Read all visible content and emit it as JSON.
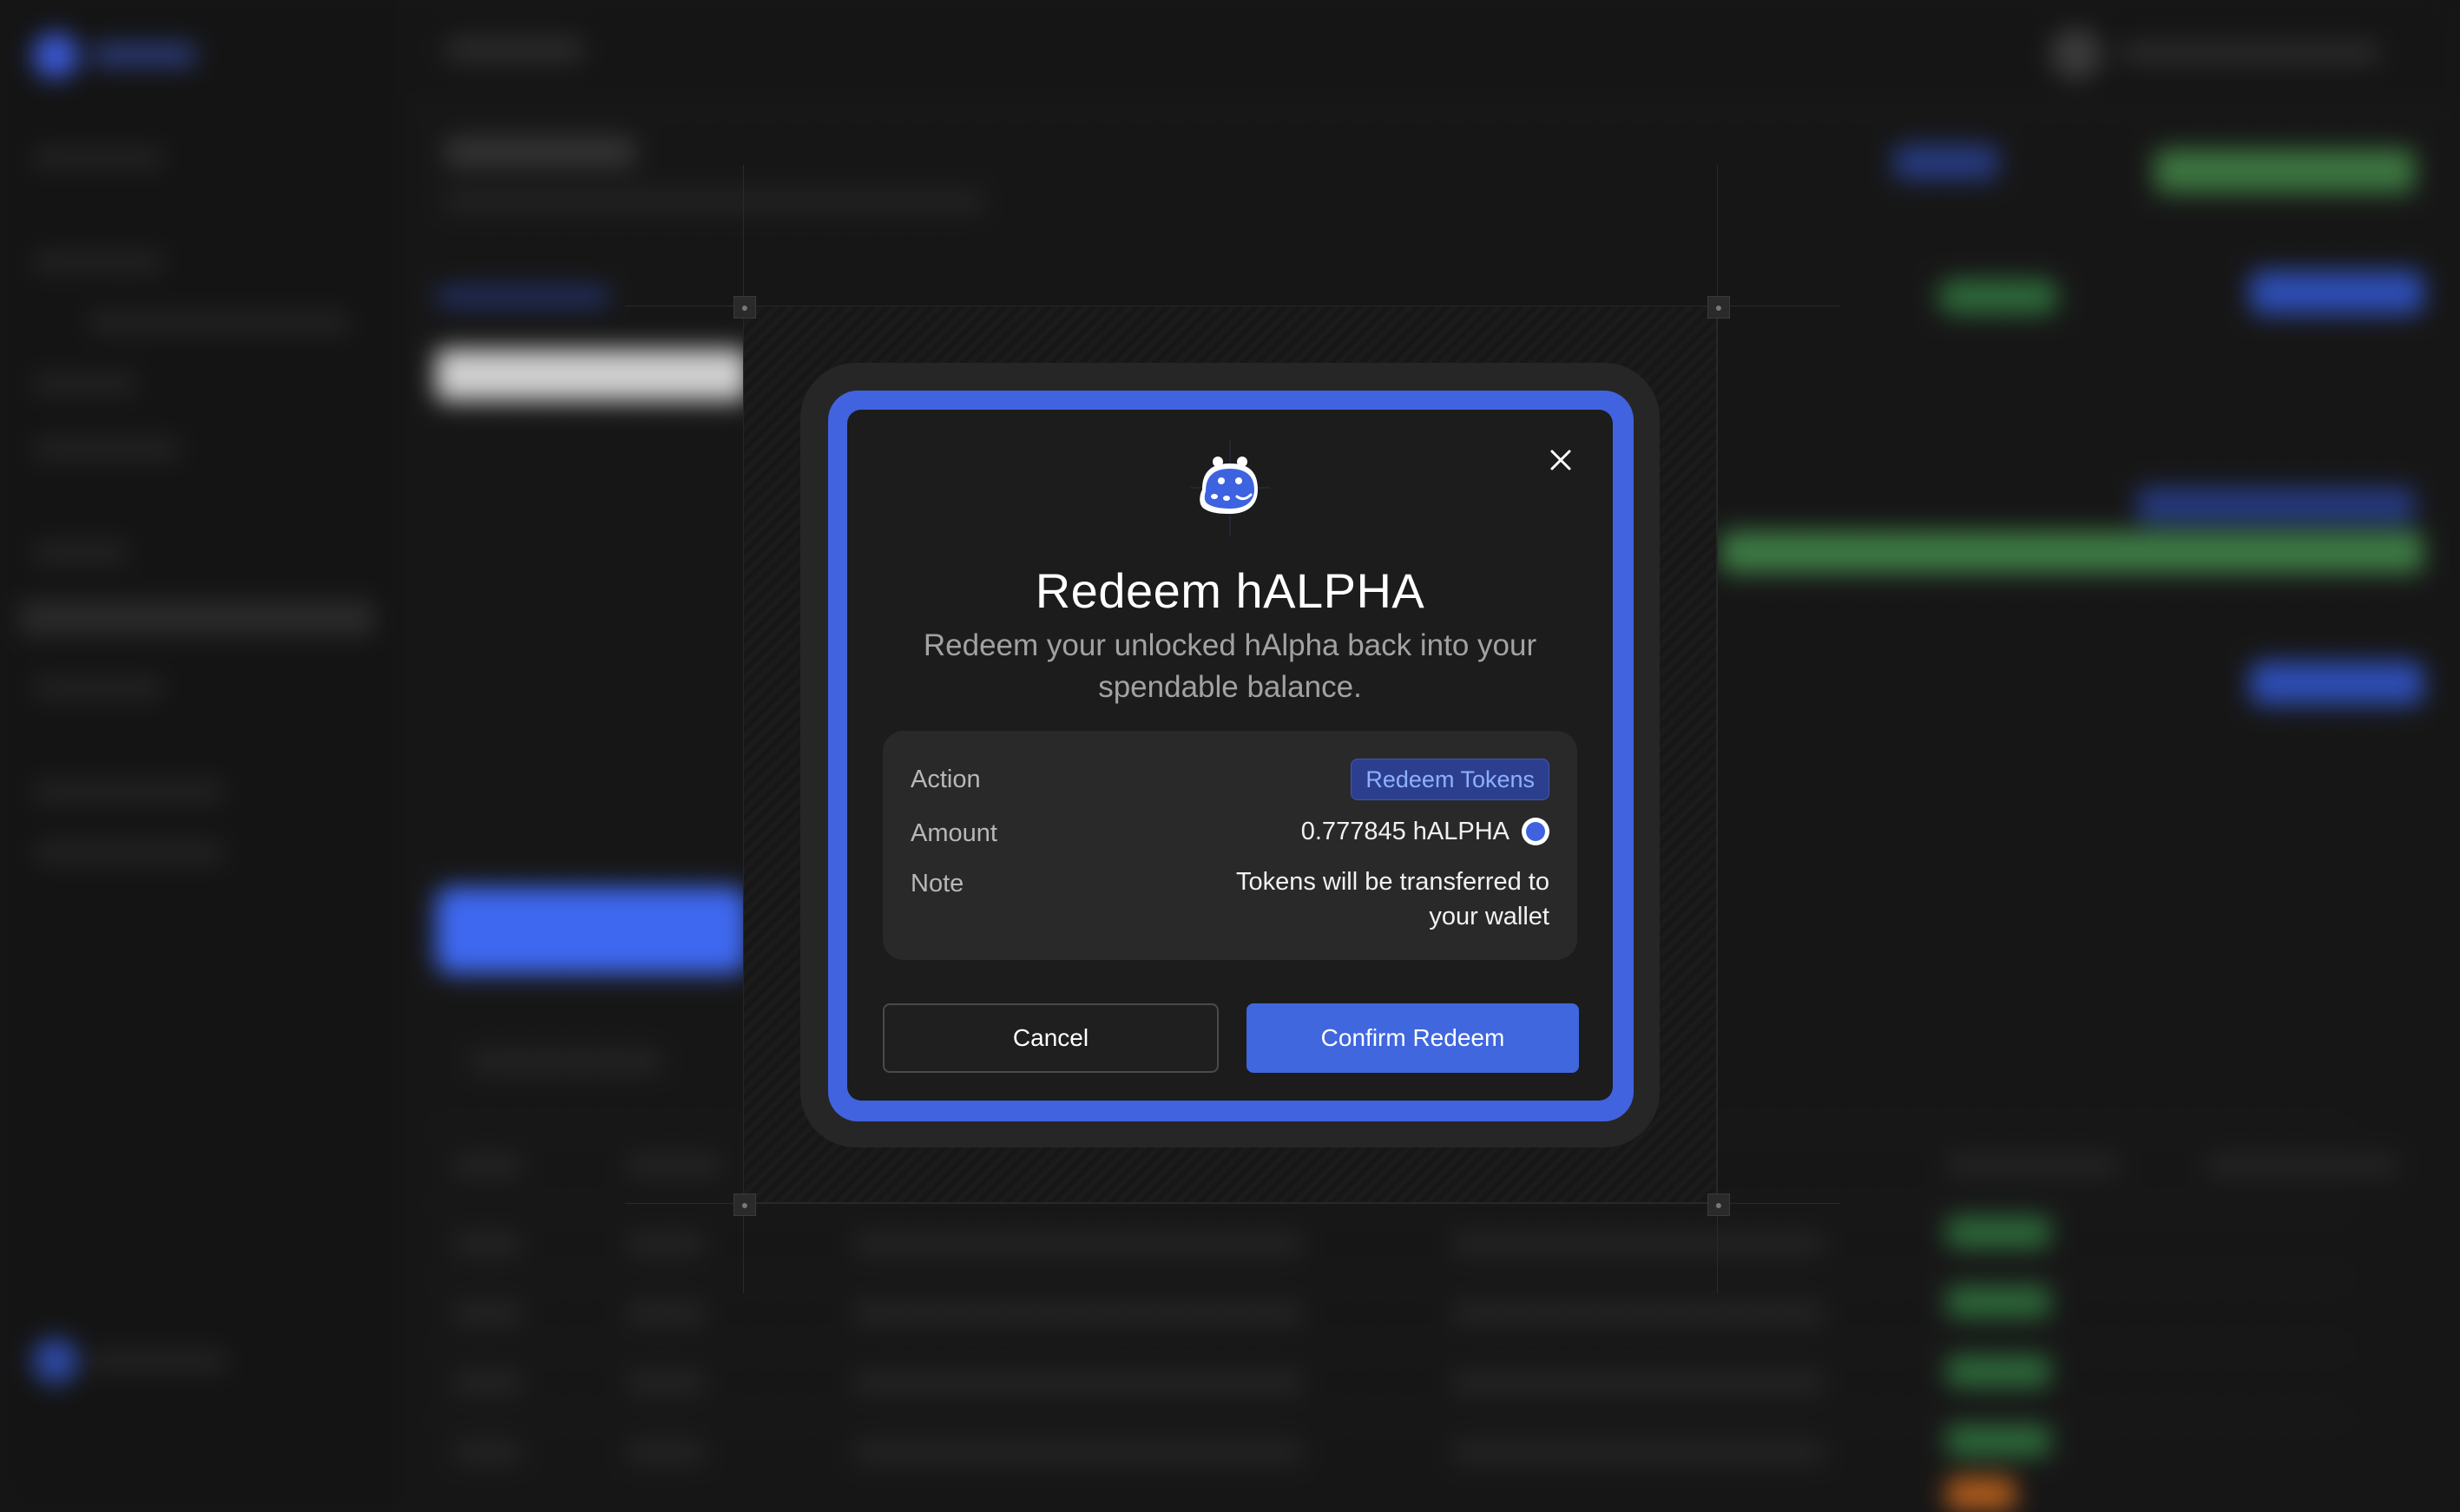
{
  "modal": {
    "title": "Redeem hALPHA",
    "subtitle": "Redeem your unlocked hAlpha back into your spendable balance.",
    "mascot_icon": "hippo-mascot-icon",
    "close_icon": "close-icon",
    "details": {
      "action_label": "Action",
      "action_value": "Redeem Tokens",
      "amount_label": "Amount",
      "amount_value": "0.777845 hALPHA",
      "amount_token_icon": "halpha-token-icon",
      "note_label": "Note",
      "note_value_line1": "Tokens will be transferred to",
      "note_value_line2": "your wallet"
    },
    "buttons": {
      "cancel_label": "Cancel",
      "confirm_label": "Confirm Redeem"
    }
  },
  "colors": {
    "accent_blue": "#4163df",
    "badge_text": "#8fb0ff",
    "card_bg": "#1c1c1c",
    "detail_bg": "#292929"
  }
}
